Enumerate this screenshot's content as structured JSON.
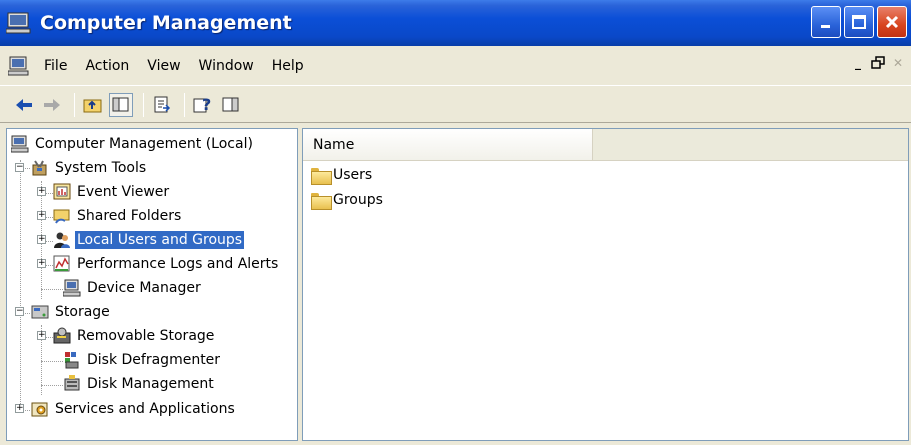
{
  "window": {
    "title": "Computer Management",
    "icon": "computer-management-icon",
    "buttons": [
      "minimize-icon",
      "maximize-icon",
      "close-icon"
    ]
  },
  "menu": {
    "items": [
      "File",
      "Action",
      "View",
      "Window",
      "Help"
    ]
  },
  "toolbar": {
    "buttons": [
      "back-arrow-icon",
      "forward-arrow-icon",
      "up-level-icon",
      "show-hide-tree-icon",
      "export-list-icon",
      "help-icon",
      "show-hide-action-pane-icon"
    ]
  },
  "tree": {
    "root": "Computer Management (Local)",
    "system_tools": "System Tools",
    "event_viewer": "Event Viewer",
    "shared_folders": "Shared Folders",
    "local_users": "Local Users and Groups",
    "perf_logs": "Performance Logs and Alerts",
    "device_manager": "Device Manager",
    "storage": "Storage",
    "removable_storage": "Removable Storage",
    "disk_defrag": "Disk Defragmenter",
    "disk_mgmt": "Disk Management",
    "services": "Services and Applications",
    "selected": "Local Users and Groups"
  },
  "list": {
    "columns": [
      "Name"
    ],
    "rows": [
      {
        "name": "Users",
        "icon": "folder-icon"
      },
      {
        "name": "Groups",
        "icon": "folder-icon"
      }
    ]
  },
  "colors": {
    "titlebar": "#0b4fd7",
    "selection": "#316ac5",
    "chrome": "#ece9d8"
  }
}
